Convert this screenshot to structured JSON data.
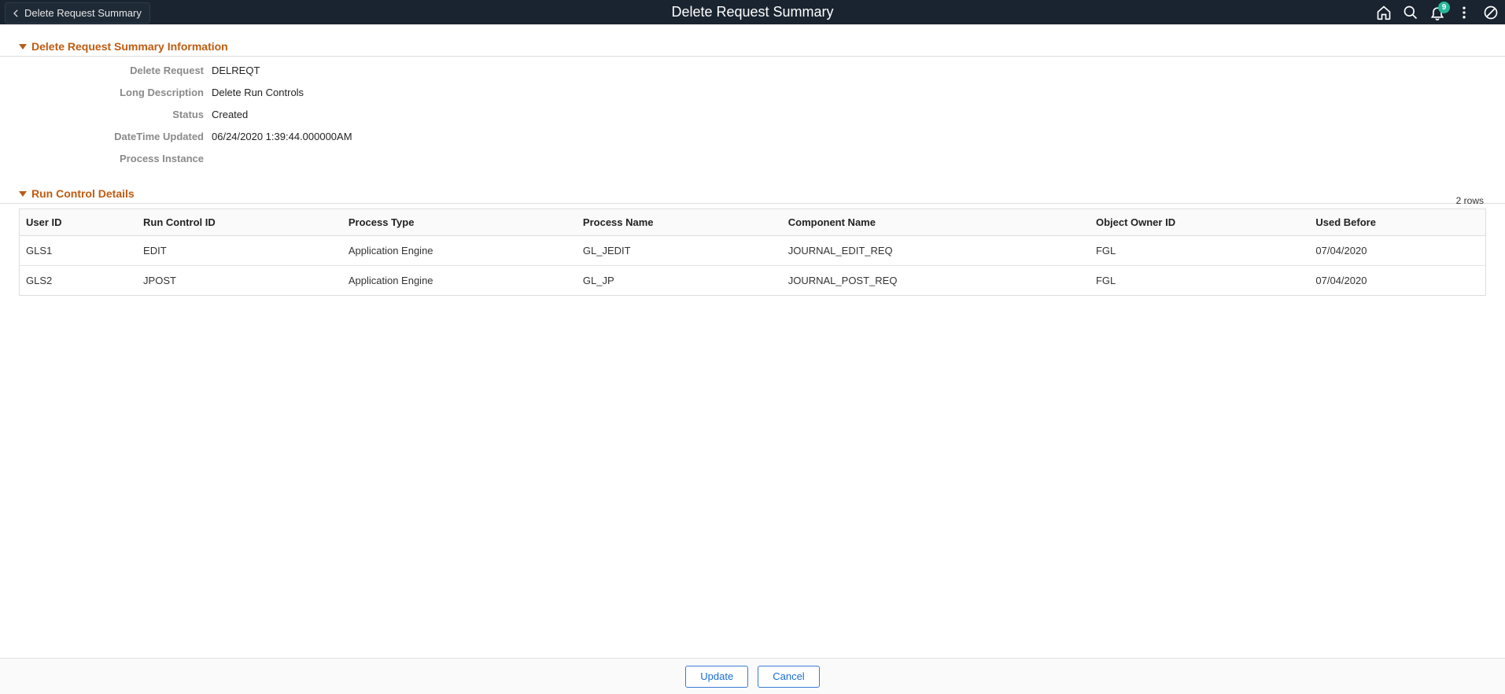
{
  "header": {
    "back_label": "Delete Request Summary",
    "page_title": "Delete Request Summary",
    "notification_count": "9"
  },
  "section1": {
    "title": "Delete Request Summary Information",
    "fields": {
      "delete_request": {
        "label": "Delete Request",
        "value": "DELREQT"
      },
      "long_description": {
        "label": "Long Description",
        "value": "Delete Run Controls"
      },
      "status": {
        "label": "Status",
        "value": "Created"
      },
      "datetime_updated": {
        "label": "DateTime Updated",
        "value": "06/24/2020  1:39:44.000000AM"
      },
      "process_instance": {
        "label": "Process Instance",
        "value": ""
      }
    }
  },
  "section2": {
    "title": "Run Control Details",
    "row_count_label": "2 rows",
    "columns": {
      "user_id": "User ID",
      "run_control_id": "Run Control ID",
      "process_type": "Process Type",
      "process_name": "Process Name",
      "component_name": "Component Name",
      "object_owner_id": "Object Owner ID",
      "used_before": "Used Before"
    },
    "rows": [
      {
        "user_id": "GLS1",
        "run_control_id": "EDIT",
        "process_type": "Application Engine",
        "process_name": "GL_JEDIT",
        "component_name": "JOURNAL_EDIT_REQ",
        "object_owner_id": "FGL",
        "used_before": "07/04/2020"
      },
      {
        "user_id": "GLS2",
        "run_control_id": "JPOST",
        "process_type": "Application Engine",
        "process_name": "GL_JP",
        "component_name": "JOURNAL_POST_REQ",
        "object_owner_id": "FGL",
        "used_before": "07/04/2020"
      }
    ]
  },
  "footer": {
    "update_label": "Update",
    "cancel_label": "Cancel"
  }
}
